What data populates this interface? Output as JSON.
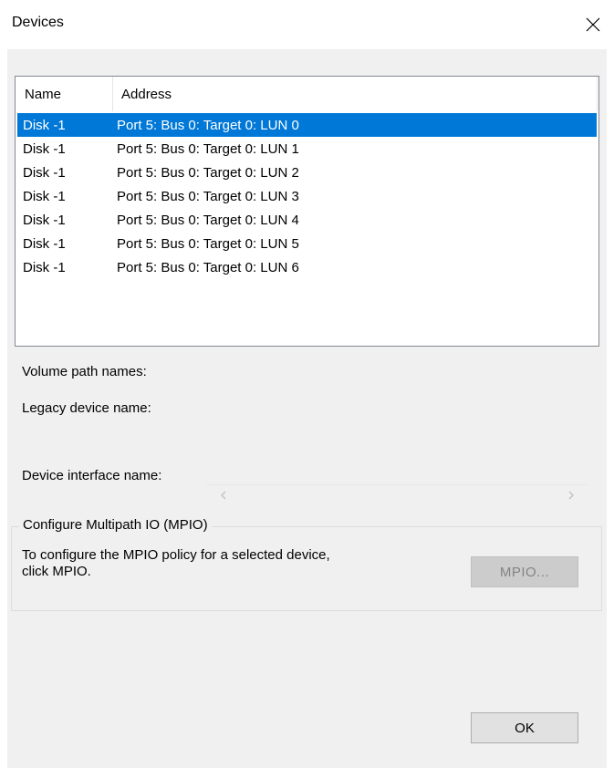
{
  "window": {
    "title": "Devices",
    "close_icon": "close-icon"
  },
  "device_list": {
    "columns": [
      "Name",
      "Address"
    ],
    "rows": [
      {
        "name": "Disk -1",
        "address": "Port 5: Bus 0: Target 0: LUN 0",
        "selected": true
      },
      {
        "name": "Disk -1",
        "address": "Port 5: Bus 0: Target 0: LUN 1",
        "selected": false
      },
      {
        "name": "Disk -1",
        "address": "Port 5: Bus 0: Target 0: LUN 2",
        "selected": false
      },
      {
        "name": "Disk -1",
        "address": "Port 5: Bus 0: Target 0: LUN 3",
        "selected": false
      },
      {
        "name": "Disk -1",
        "address": "Port 5: Bus 0: Target 0: LUN 4",
        "selected": false
      },
      {
        "name": "Disk -1",
        "address": "Port 5: Bus 0: Target 0: LUN 5",
        "selected": false
      },
      {
        "name": "Disk -1",
        "address": "Port 5: Bus 0: Target 0: LUN 6",
        "selected": false
      }
    ]
  },
  "details": {
    "volume_path_label": "Volume path names:",
    "legacy_device_label": "Legacy device name:",
    "device_interface_label": "Device interface name:"
  },
  "mpio_group": {
    "legend": "Configure Multipath IO (MPIO)",
    "description": "To configure the MPIO policy for a selected device, click MPIO.",
    "button_label": "MPIO..."
  },
  "footer": {
    "ok_label": "OK"
  },
  "colors": {
    "selection": "#0078d7",
    "dialog_background": "#f0f0f0"
  }
}
